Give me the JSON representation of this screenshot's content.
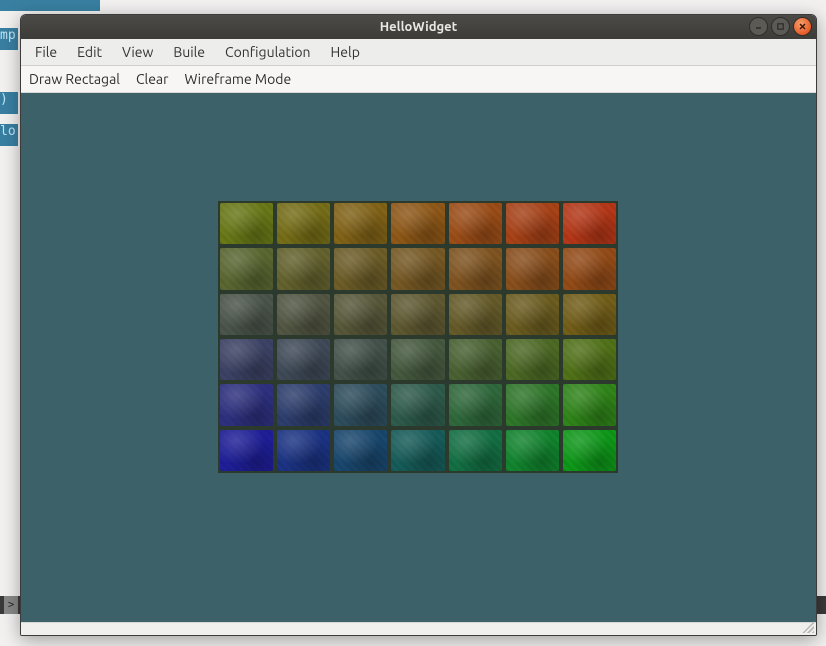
{
  "window": {
    "title": "HelloWidget"
  },
  "menubar": {
    "items": [
      "File",
      "Edit",
      "View",
      "Buile",
      "Configulation",
      "Help"
    ]
  },
  "toolbar": {
    "items": [
      "Draw Rectagal",
      "Clear",
      "Wireframe Mode"
    ]
  },
  "background_fragments": {
    "a": "mp",
    "b": ")",
    "c": "lo",
    "arrow": ">"
  },
  "canvas": {
    "grid": {
      "cols": 7,
      "rows": 6
    },
    "corner_colors": {
      "top_left": "#6a7a18",
      "top_right": "#b63818",
      "bottom_left": "#1f1f9a",
      "bottom_right": "#0f9a1a"
    }
  }
}
